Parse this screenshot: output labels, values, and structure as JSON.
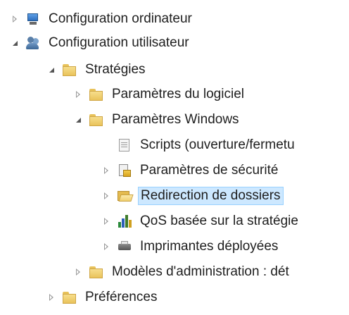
{
  "tree": {
    "items": [
      {
        "label": "Configuration ordinateur",
        "icon": "computer-icon",
        "state": "collapsed"
      },
      {
        "label": "Configuration utilisateur",
        "icon": "users-icon",
        "state": "expanded"
      },
      {
        "label": "Stratégies",
        "icon": "folder-icon",
        "state": "expanded"
      },
      {
        "label": "Paramètres du logiciel",
        "icon": "folder-icon",
        "state": "collapsed"
      },
      {
        "label": "Paramètres Windows",
        "icon": "folder-icon",
        "state": "expanded"
      },
      {
        "label": "Scripts (ouverture/fermetu",
        "icon": "script-icon",
        "state": "none"
      },
      {
        "label": "Paramètres de sécurité",
        "icon": "security-icon",
        "state": "collapsed"
      },
      {
        "label": "Redirection de dossiers",
        "icon": "open-folder-icon",
        "state": "collapsed",
        "selected": true
      },
      {
        "label": "QoS basée sur la stratégie",
        "icon": "chart-icon",
        "state": "collapsed"
      },
      {
        "label": "Imprimantes déployées",
        "icon": "printer-icon",
        "state": "collapsed"
      },
      {
        "label": "Modèles d'administration : dét",
        "icon": "folder-icon",
        "state": "collapsed"
      },
      {
        "label": "Préférences",
        "icon": "folder-icon",
        "state": "collapsed"
      }
    ]
  },
  "colors": {
    "selection_bg": "#cde8ff",
    "selection_border": "#99d1ff",
    "folder": "#f0d071"
  }
}
